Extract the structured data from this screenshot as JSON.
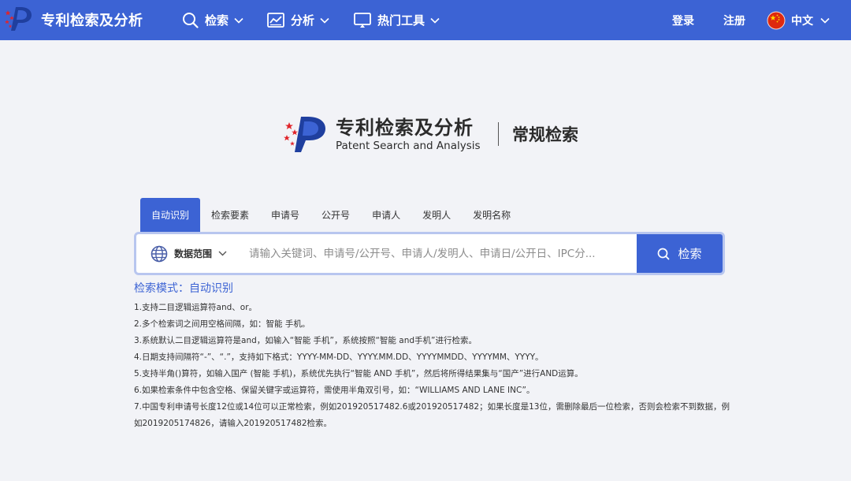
{
  "header": {
    "brand": "专利检索及分析",
    "nav": [
      {
        "label": "检索",
        "icon": "search-icon"
      },
      {
        "label": "分析",
        "icon": "chart-icon"
      },
      {
        "label": "热门工具",
        "icon": "monitor-icon"
      }
    ],
    "login": "登录",
    "register": "注册",
    "language": "中文",
    "colors": {
      "bar": "#3c63d4"
    }
  },
  "hero": {
    "title_cn": "专利检索及分析",
    "title_en": "Patent Search and Analysis",
    "mode": "常规检索"
  },
  "tabs": [
    {
      "label": "自动识别",
      "active": true
    },
    {
      "label": "检索要素",
      "active": false
    },
    {
      "label": "申请号",
      "active": false
    },
    {
      "label": "公开号",
      "active": false
    },
    {
      "label": "申请人",
      "active": false
    },
    {
      "label": "发明人",
      "active": false
    },
    {
      "label": "发明名称",
      "active": false
    }
  ],
  "search": {
    "scope_label": "数据范围",
    "placeholder": "请输入关键词、申请号/公开号、申请人/发明人、申请日/公开日、IPC分...",
    "button_label": "检索"
  },
  "mode_line": "检索模式：自动识别",
  "help": [
    "1.支持二目逻辑运算符and、or。",
    "2.多个检索词之间用空格间隔，如：智能 手机。",
    "3.系统默认二目逻辑运算符是and，如输入“智能 手机”，系统按照“智能 and手机”进行检索。",
    "4.日期支持间隔符“-”、“.”，支持如下格式：YYYY-MM-DD、YYYY.MM.DD、YYYYMMDD、YYYYMM、YYYY。",
    "5.支持半角()算符，如输入国产 (智能 手机)，系统优先执行“智能 AND 手机”，然后将所得结果集与“国产”进行AND运算。",
    "6.如果检索条件中包含空格、保留关键字或运算符，需使用半角双引号，如：“WILLIAMS AND LANE INC”。",
    "7.中国专利申请号长度12位或14位可以正常检索，例如201920517482.6或201920517482；如果长度是13位，需删除最后一位检索，否则会检索不到数据，例如2019205174826，请输入201920517482检索。"
  ]
}
